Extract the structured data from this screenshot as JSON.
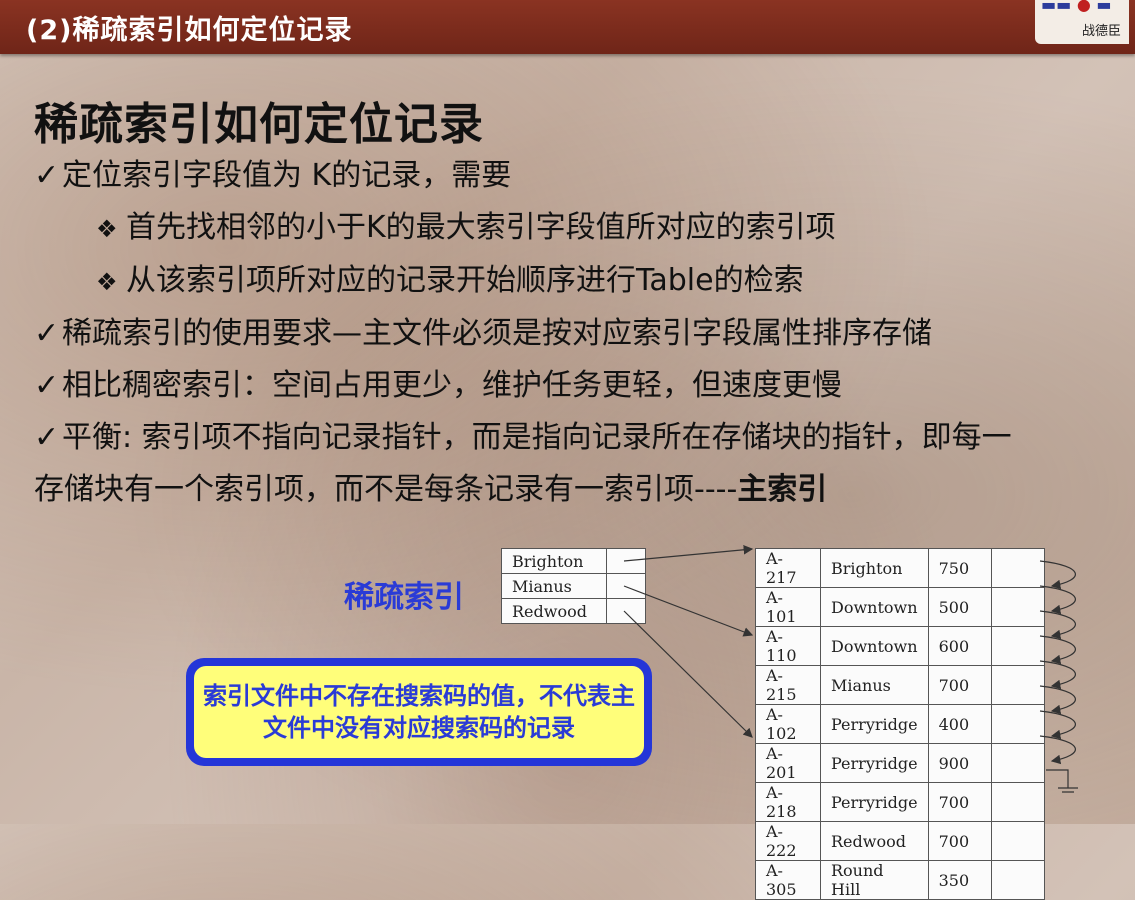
{
  "header": {
    "title": "(2)稀疏索引如何定位记录",
    "logo_text": "战德臣"
  },
  "page_title": "稀疏索引如何定位记录",
  "bullets": [
    {
      "level": 1,
      "text": "定位索引字段值为 K的记录，需要"
    },
    {
      "level": 2,
      "text": "首先找相邻的小于K的最大索引字段值所对应的索引项"
    },
    {
      "level": 2,
      "text": "从该索引项所对应的记录开始顺序进行Table的检索"
    },
    {
      "level": 1,
      "text": "稀疏索引的使用要求—主文件必须是按对应索引字段属性排序存储"
    },
    {
      "level": 1,
      "text": "相比稠密索引：空间占用更少，维护任务更轻，但速度更慢"
    },
    {
      "level": 1,
      "text": "平衡: 索引项不指向记录指针，而是指向记录所在存储块的指针，即每一",
      "cont": "存储块有一个索引项，而不是每条记录有一索引项----",
      "bold": "主索引"
    }
  ],
  "sparse_label": "稀疏索引",
  "callout": "索引文件中不存在搜索码的值，不代表主文件中没有对应搜索码的记录",
  "index_file": [
    "Brighton",
    "Mianus",
    "Redwood"
  ],
  "main_file": [
    [
      "A-217",
      "Brighton",
      "750"
    ],
    [
      "A-101",
      "Downtown",
      "500"
    ],
    [
      "A-110",
      "Downtown",
      "600"
    ],
    [
      "A-215",
      "Mianus",
      "700"
    ],
    [
      "A-102",
      "Perryridge",
      "400"
    ],
    [
      "A-201",
      "Perryridge",
      "900"
    ],
    [
      "A-218",
      "Perryridge",
      "700"
    ],
    [
      "A-222",
      "Redwood",
      "700"
    ],
    [
      "A-305",
      "Round Hill",
      "350"
    ]
  ],
  "colors": {
    "header": "#7a2a1c",
    "accent_blue": "#2a3bd6",
    "callout_fill": "#fffe7a"
  }
}
